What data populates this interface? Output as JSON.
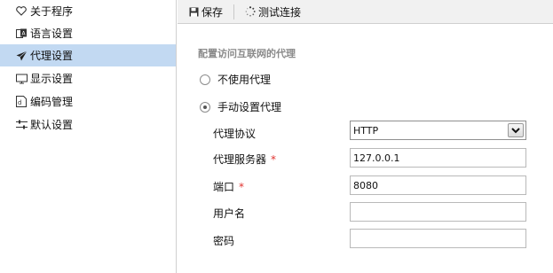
{
  "sidebar": {
    "items": [
      {
        "label": "关于程序",
        "icon": "heart-icon"
      },
      {
        "label": "语言设置",
        "icon": "language-icon"
      },
      {
        "label": "代理设置",
        "icon": "paper-plane-icon",
        "active": true
      },
      {
        "label": "显示设置",
        "icon": "monitor-icon"
      },
      {
        "label": "编码管理",
        "icon": "encoding-icon"
      },
      {
        "label": "默认设置",
        "icon": "sliders-icon"
      }
    ]
  },
  "toolbar": {
    "save_label": "保存",
    "test_label": "测试连接"
  },
  "proxy": {
    "section_title": "配置访问互联网的代理",
    "option_none": "不使用代理",
    "option_manual": "手动设置代理",
    "selected_option": "manual",
    "protocol_label": "代理协议",
    "protocol_value": "HTTP",
    "server_label": "代理服务器",
    "server_value": "127.0.0.1",
    "port_label": "端口",
    "port_value": "8080",
    "username_label": "用户名",
    "username_value": "",
    "password_label": "密码",
    "password_value": "",
    "required_mark": "*"
  },
  "colors": {
    "active_item_bg": "#c2d9f2",
    "required": "#e0322f",
    "section_title": "#8a8a8a"
  }
}
